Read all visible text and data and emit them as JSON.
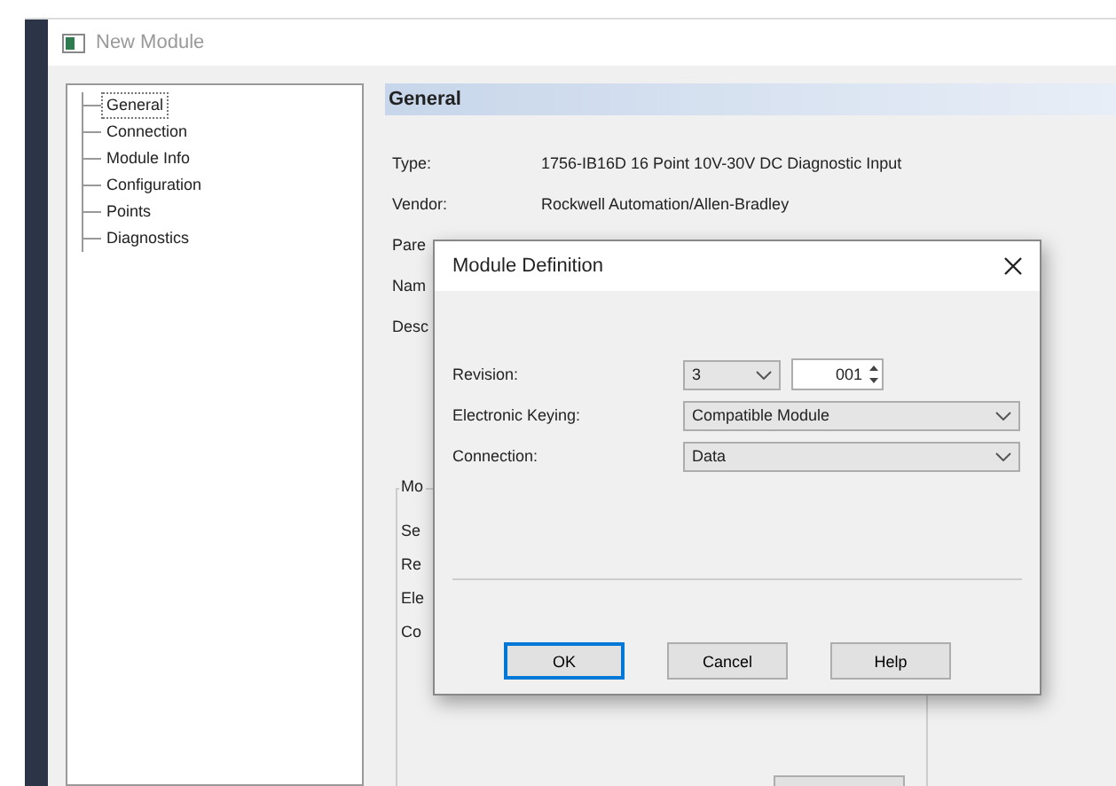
{
  "window": {
    "title": "New Module"
  },
  "tree": {
    "items": [
      {
        "label": "General",
        "selected": true
      },
      {
        "label": "Connection",
        "selected": false
      },
      {
        "label": "Module Info",
        "selected": false
      },
      {
        "label": "Configuration",
        "selected": false
      },
      {
        "label": "Points",
        "selected": false
      },
      {
        "label": "Diagnostics",
        "selected": false
      }
    ]
  },
  "general": {
    "header": "General",
    "fields": [
      {
        "label": "Type:",
        "value": "1756-IB16D 16 Point 10V-30V DC Diagnostic Input"
      },
      {
        "label": "Vendor:",
        "value": "Rockwell Automation/Allen-Bradley"
      },
      {
        "label": "Pare"
      },
      {
        "label": "Nam"
      },
      {
        "label": "Desc"
      }
    ],
    "group": {
      "title": "Mo",
      "labels": [
        "Se",
        "Re",
        "Ele",
        "Co"
      ]
    }
  },
  "dialog": {
    "title": "Module Definition",
    "fields": [
      {
        "kind": "revision",
        "label": "Revision:",
        "major": "3",
        "minor": "001"
      },
      {
        "kind": "combo",
        "label": "Electronic Keying:",
        "value": "Compatible Module"
      },
      {
        "kind": "combo",
        "label": "Connection:",
        "value": "Data"
      }
    ],
    "buttons": [
      {
        "label": "OK",
        "default": true
      },
      {
        "label": "Cancel",
        "default": false
      },
      {
        "label": "Help",
        "default": false
      }
    ]
  }
}
